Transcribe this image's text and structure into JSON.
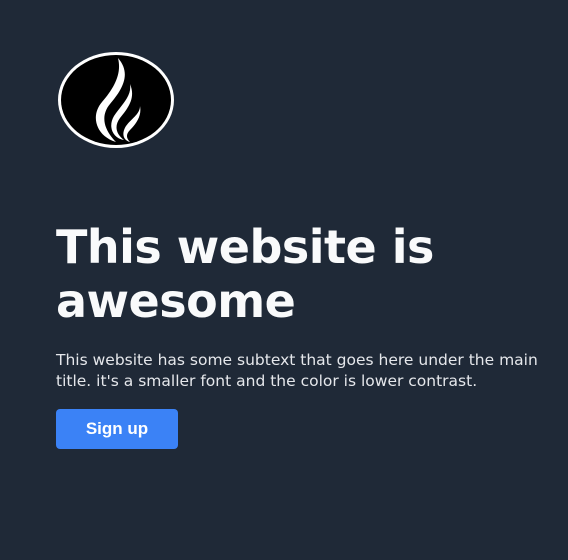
{
  "hero": {
    "logo_icon": "flame-logo-icon",
    "title": "This website is awesome",
    "subtext": "This website has some subtext that goes here under the main title. it's a smaller font and the color is lower contrast.",
    "signup_label": "Sign up"
  },
  "colors": {
    "background": "#1f2937",
    "title": "#f9fafb",
    "subtext": "#e5e7eb",
    "button": "#3b82f6",
    "button_text": "#ffffff"
  }
}
